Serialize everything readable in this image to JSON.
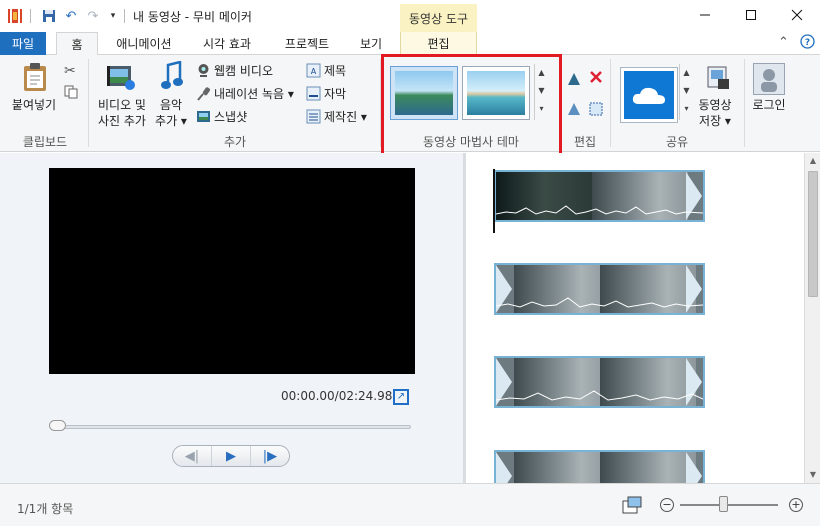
{
  "window": {
    "title": "내 동영상 - 무비 메이커",
    "context_tab_group": "동영상 도구"
  },
  "quick_access": {
    "icons": [
      "movie-maker-icon",
      "save-icon",
      "undo-icon",
      "redo-icon",
      "customize-icon"
    ]
  },
  "tabs": {
    "file": "파일",
    "home": "홈",
    "animations": "애니메이션",
    "visual_effects": "시각 효과",
    "project": "프로젝트",
    "view": "보기",
    "edit": "편집"
  },
  "ribbon": {
    "clipboard": {
      "label": "클립보드",
      "paste": "붙여넣기"
    },
    "add": {
      "label": "추가",
      "add_videos_photos_line1": "비디오 및",
      "add_videos_photos_line2": "사진 추가",
      "add_music_line1": "음악",
      "add_music_line2": "추가 ▾",
      "webcam_video": "웹캠 비디오",
      "record_narration": "내레이션 녹음 ▾",
      "snapshot": "스냅샷",
      "title": "제목",
      "caption": "자막",
      "credits": "제작진 ▾"
    },
    "themes": {
      "label": "동영상 마법사 테마"
    },
    "editing": {
      "label": "편집"
    },
    "share": {
      "label": "공유",
      "save_movie_line1": "동영상",
      "save_movie_line2": "저장 ▾"
    },
    "signin": {
      "label": "로그인"
    }
  },
  "preview": {
    "timecode": "00:00.00/02:24.98",
    "progress": 0
  },
  "storyboard": {
    "clip_count": 4
  },
  "status": {
    "item_count": "1/1개 항목",
    "zoom_level": 0.4
  },
  "colors": {
    "accent": "#1f6fbf",
    "context_tab": "#faf2c2",
    "highlight_box": "#e21b23",
    "clip_border": "#78b3d6"
  }
}
